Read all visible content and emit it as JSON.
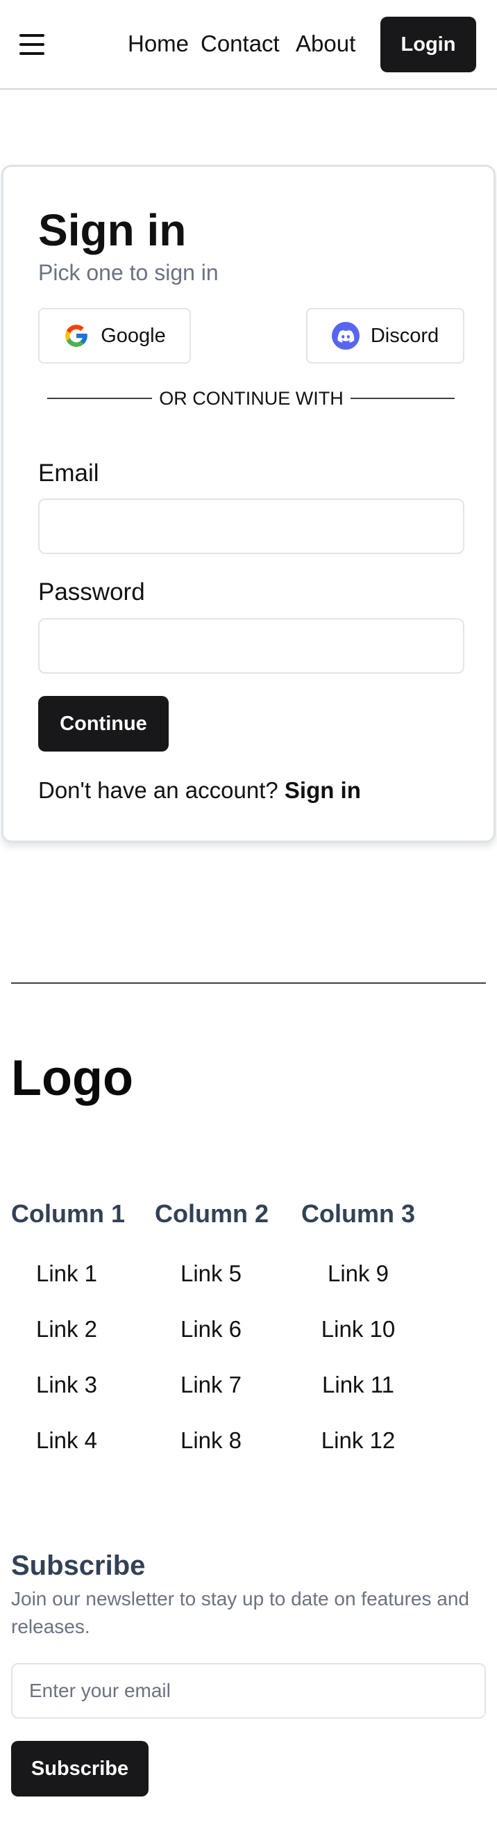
{
  "header": {
    "menu_icon": "hamburger-menu-icon",
    "nav": [
      "Home",
      "Contact",
      "About"
    ],
    "login_label": "Login"
  },
  "signin": {
    "title": "Sign in",
    "subtitle": "Pick one to sign in",
    "providers": [
      {
        "label": "Google",
        "icon": "google-icon"
      },
      {
        "label": "Discord",
        "icon": "discord-icon"
      }
    ],
    "divider": "OR CONTINUE WITH",
    "email_label": "Email",
    "email_value": "",
    "password_label": "Password",
    "password_value": "",
    "continue_label": "Continue",
    "no_account_text": "Don't have an account?",
    "signup_link": "Sign in",
    "colors": {
      "discord": "#5865f2",
      "primary": "#18181b"
    }
  },
  "footer": {
    "logo": "Logo",
    "columns": [
      {
        "title": "Column 1",
        "links": [
          "Link 1",
          "Link 2",
          "Link 3",
          "Link 4"
        ]
      },
      {
        "title": "Column 2",
        "links": [
          "Link 5",
          "Link 6",
          "Link 7",
          "Link 8"
        ]
      },
      {
        "title": "Column 3",
        "links": [
          "Link 9",
          "Link 10",
          "Link 11",
          "Link 12"
        ]
      }
    ],
    "subscribe": {
      "title": "Subscribe",
      "description": "Join our newsletter to stay up to date on features and releases.",
      "placeholder": "Enter your email",
      "button": "Subscribe"
    }
  }
}
